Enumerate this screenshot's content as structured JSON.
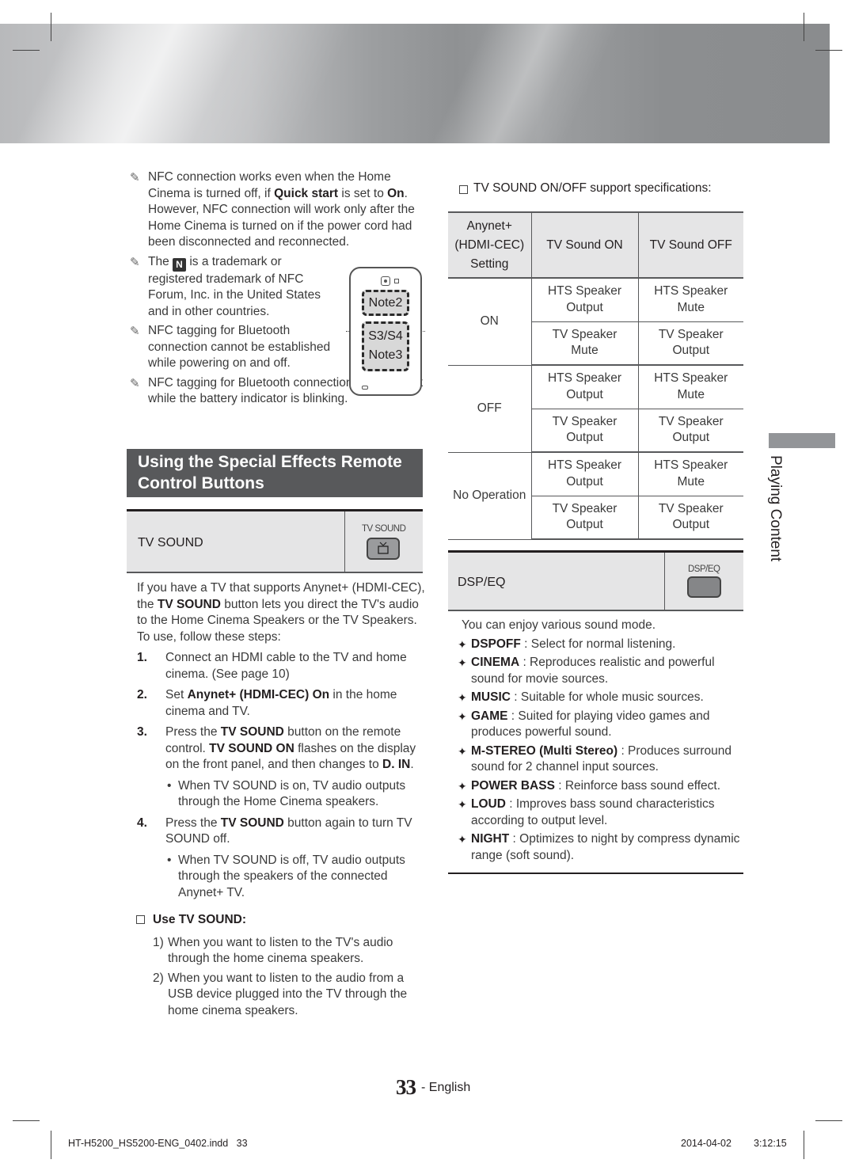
{
  "nfc_notes": [
    {
      "parts": [
        "NFC connection works even when the Home Cinema is turned off, if ",
        "Quick start",
        " is set to ",
        "On",
        ". However, NFC connection will work only after the Home Cinema is turned on if the power cord had been disconnected and reconnected."
      ]
    },
    {
      "before": "The ",
      "logo": "N",
      "after": " is a trademark or registered trademark of NFC Forum, Inc. in the United States and in other countries."
    },
    {
      "text": "NFC tagging for Bluetooth connection cannot be established while powering on and off."
    },
    {
      "text": "NFC tagging for Bluetooth connection will not work while the battery indicator is blinking."
    }
  ],
  "phone_illustration": {
    "tag_top": "Note2",
    "tag_bottom_line1": "S3/S4",
    "tag_bottom_line2": "Note3"
  },
  "section_title": "Using the Special Effects Remote Control Buttons",
  "tv_sound_box": {
    "label": "TV SOUND",
    "button_caption": "TV SOUND",
    "button_icon": "tv-icon"
  },
  "intro": {
    "p1": "If you have a TV that supports Anynet+ (HDMI-CEC), the ",
    "b1": "TV SOUND",
    "p2": " button lets you direct the TV's audio to the Home Cinema Speakers or the TV Speakers. To use, follow these steps:"
  },
  "steps": [
    {
      "num": "1.",
      "text": "Connect an HDMI cable to the TV and home cinema. (See page 10)"
    },
    {
      "num": "2.",
      "a": "Set ",
      "b": "Anynet+ (HDMI-CEC) On",
      "c": " in the home cinema and TV."
    },
    {
      "num": "3.",
      "a": "Press the ",
      "b": "TV SOUND",
      "c": " button on the remote control. ",
      "d": "TV SOUND ON",
      "e": " flashes on the display on the front panel, and then changes to ",
      "f": "D. IN",
      "g": ".",
      "bullet": "When TV SOUND is on, TV audio outputs through the Home Cinema speakers."
    },
    {
      "num": "4.",
      "a": "Press the ",
      "b": "TV SOUND",
      "c": " button again to turn TV SOUND off.",
      "bullet": "When TV SOUND is off, TV audio outputs through the speakers of the connected Anynet+ TV."
    }
  ],
  "use_tv_sound": {
    "heading": "Use TV SOUND:",
    "items": [
      {
        "n": "1)",
        "text": "When you want to listen to the TV's audio through the home cinema speakers."
      },
      {
        "n": "2)",
        "text": "When you want to listen to the audio from a USB device plugged into the TV through the home cinema speakers."
      }
    ]
  },
  "spec_table": {
    "heading": "TV SOUND ON/OFF support specifications:",
    "headers": {
      "setting_l1": "Anynet+",
      "setting_l2": "(HDMI-CEC)",
      "setting_l3": "Setting",
      "on": "TV Sound ON",
      "off": "TV Sound OFF"
    },
    "groups": [
      {
        "setting": "ON",
        "rows": [
          {
            "on_1": "HTS Speaker",
            "on_2": "Output",
            "off_1": "HTS Speaker",
            "off_2": "Mute"
          },
          {
            "on_1": "TV Speaker",
            "on_2": "Mute",
            "off_1": "TV Speaker",
            "off_2": "Output"
          }
        ]
      },
      {
        "setting": "OFF",
        "rows": [
          {
            "on_1": "HTS Speaker",
            "on_2": "Output",
            "off_1": "HTS Speaker",
            "off_2": "Mute"
          },
          {
            "on_1": "TV Speaker",
            "on_2": "Output",
            "off_1": "TV Speaker",
            "off_2": "Output"
          }
        ]
      },
      {
        "setting": "No Operation",
        "rows": [
          {
            "on_1": "HTS Speaker",
            "on_2": "Output",
            "off_1": "HTS Speaker",
            "off_2": "Mute"
          },
          {
            "on_1": "TV Speaker",
            "on_2": "Output",
            "off_1": "TV Speaker",
            "off_2": "Output"
          }
        ]
      }
    ]
  },
  "dsp_box": {
    "label": "DSP/EQ",
    "button_caption": "DSP/EQ"
  },
  "dsp": {
    "intro": "You can enjoy various sound mode.",
    "modes": [
      {
        "name": "DSPOFF",
        "desc": " : Select for normal listening."
      },
      {
        "name": "CINEMA",
        "desc": " : Reproduces realistic and powerful sound for movie sources."
      },
      {
        "name": "MUSIC",
        "desc": " : Suitable for whole music sources."
      },
      {
        "name": "GAME",
        "desc": " : Suited for playing video games and produces powerful sound."
      },
      {
        "name": "M-STEREO (Multi Stereo)",
        "desc": " : Produces surround sound for 2 channel input sources."
      },
      {
        "name": "POWER BASS",
        "desc": " : Reinforce bass sound effect."
      },
      {
        "name": "LOUD",
        "desc": " : Improves bass sound characteristics according to output level."
      },
      {
        "name": "NIGHT",
        "desc": " : Optimizes to night by compress dynamic range (soft sound)."
      }
    ],
    "bullet_glyph": "✦"
  },
  "side_tab": "Playing Content",
  "footer": {
    "page_number": "33",
    "page_suffix": "- English",
    "file_slug": "HT-H5200_HS5200-ENG_0402.indd   33",
    "date": "2014-04-02",
    "time": "3:12:15"
  }
}
